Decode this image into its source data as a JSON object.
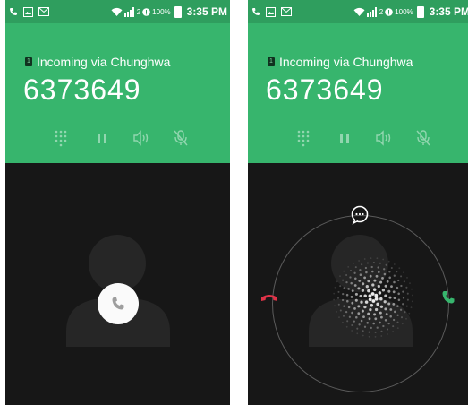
{
  "status_bar": {
    "time": "3:35 PM",
    "battery_percent": "100%",
    "signal_extra": "2"
  },
  "call": {
    "via_label": "Incoming via Chunghwa",
    "sim_slot": "1",
    "number": "6373649"
  },
  "controls": [
    "dialpad-icon",
    "hold-icon",
    "speaker-icon",
    "mute-icon"
  ],
  "colors": {
    "status_bar": "#2f9e5e",
    "header": "#37b56d",
    "background": "#171717",
    "decline": "#e03348",
    "accept": "#37b56d"
  }
}
